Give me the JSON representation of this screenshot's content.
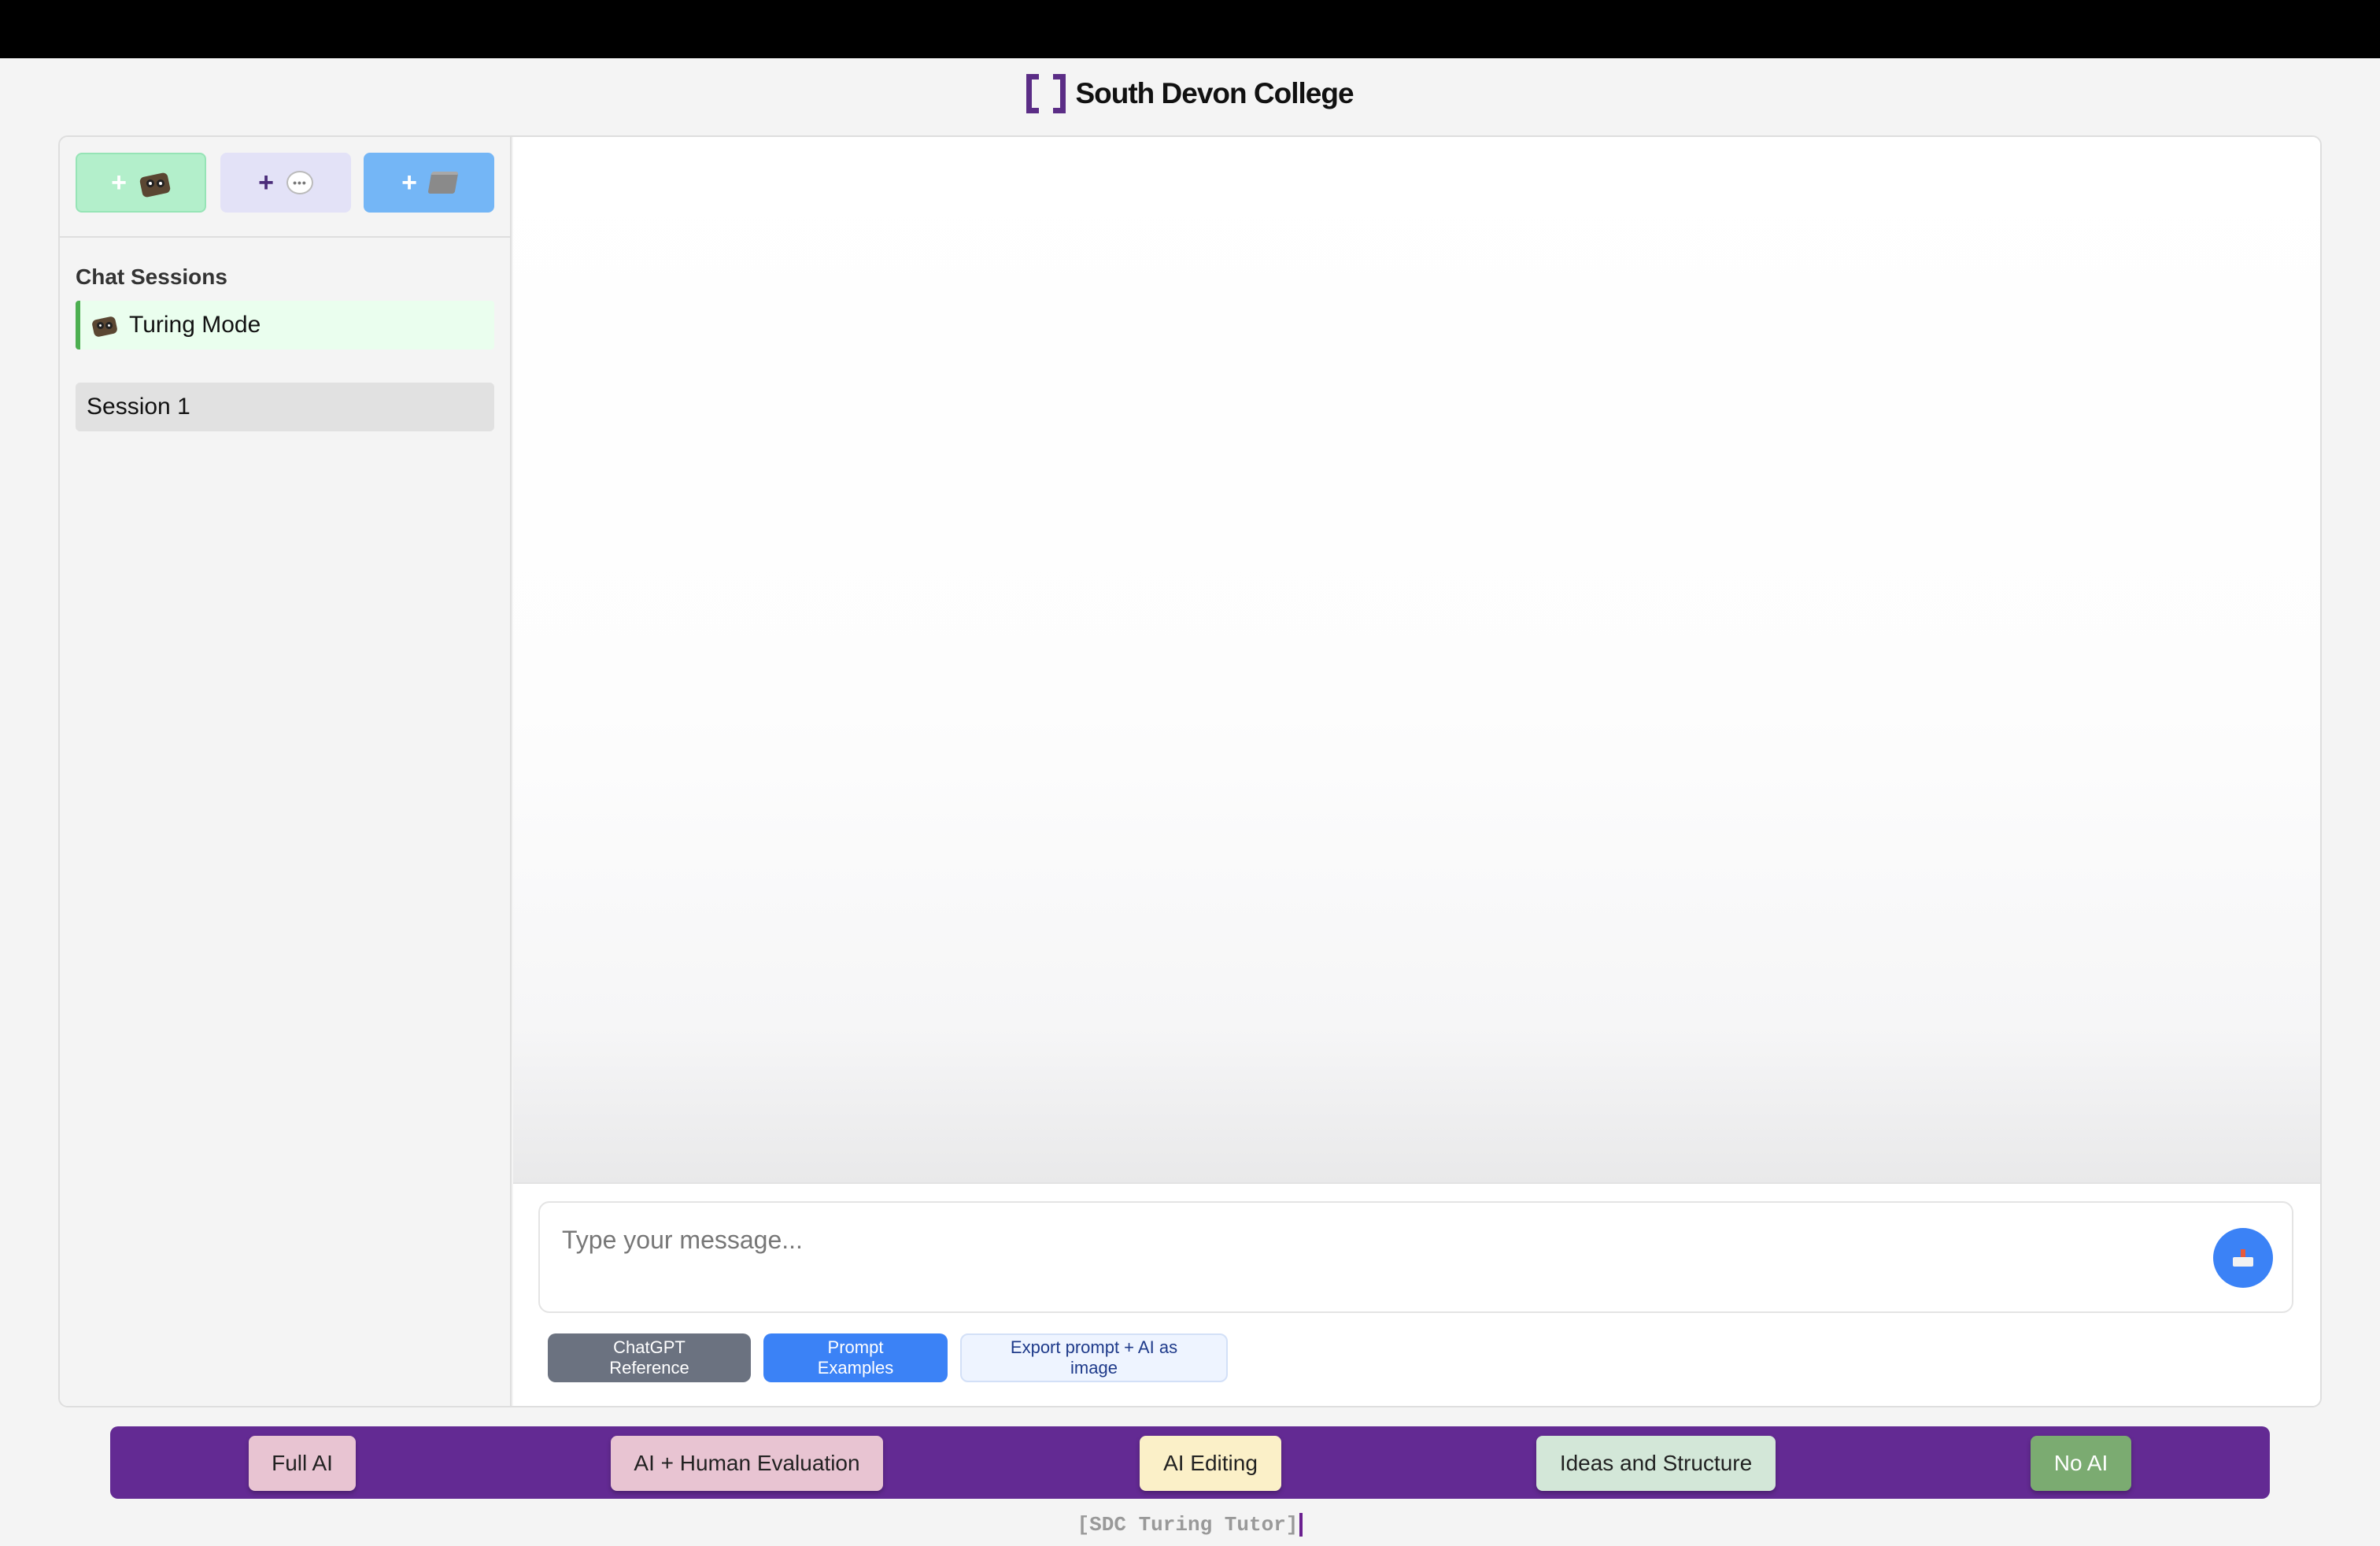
{
  "header": {
    "brand_name": "South Devon College",
    "brand_color": "#5b2d86"
  },
  "sidebar": {
    "new_buttons": [
      {
        "icon": "robot-icon",
        "plus": "+",
        "color": "#b3efcb"
      },
      {
        "icon": "chat-bubble-icon",
        "plus": "+",
        "color": "#e3e2f7"
      },
      {
        "icon": "folder-icon",
        "plus": "+",
        "color": "#74b6f6"
      }
    ],
    "section_title": "Chat Sessions",
    "mode_item": "Turing Mode",
    "sessions": [
      "Session 1"
    ]
  },
  "chat": {
    "input_placeholder": "Type your message...",
    "input_value": "",
    "send_icon": "send-tray-icon",
    "tool_buttons": {
      "reference": "ChatGPT Reference",
      "examples": "Prompt Examples",
      "export": "Export prompt + AI as image"
    }
  },
  "modes": {
    "full_ai": "Full AI",
    "ai_human_eval": "AI + Human Evaluation",
    "ai_editing": "AI Editing",
    "ideas_structure": "Ideas and Structure",
    "no_ai": "No AI",
    "bar_color": "#632a93"
  },
  "footer": {
    "text": "[SDC Turing Tutor]"
  }
}
